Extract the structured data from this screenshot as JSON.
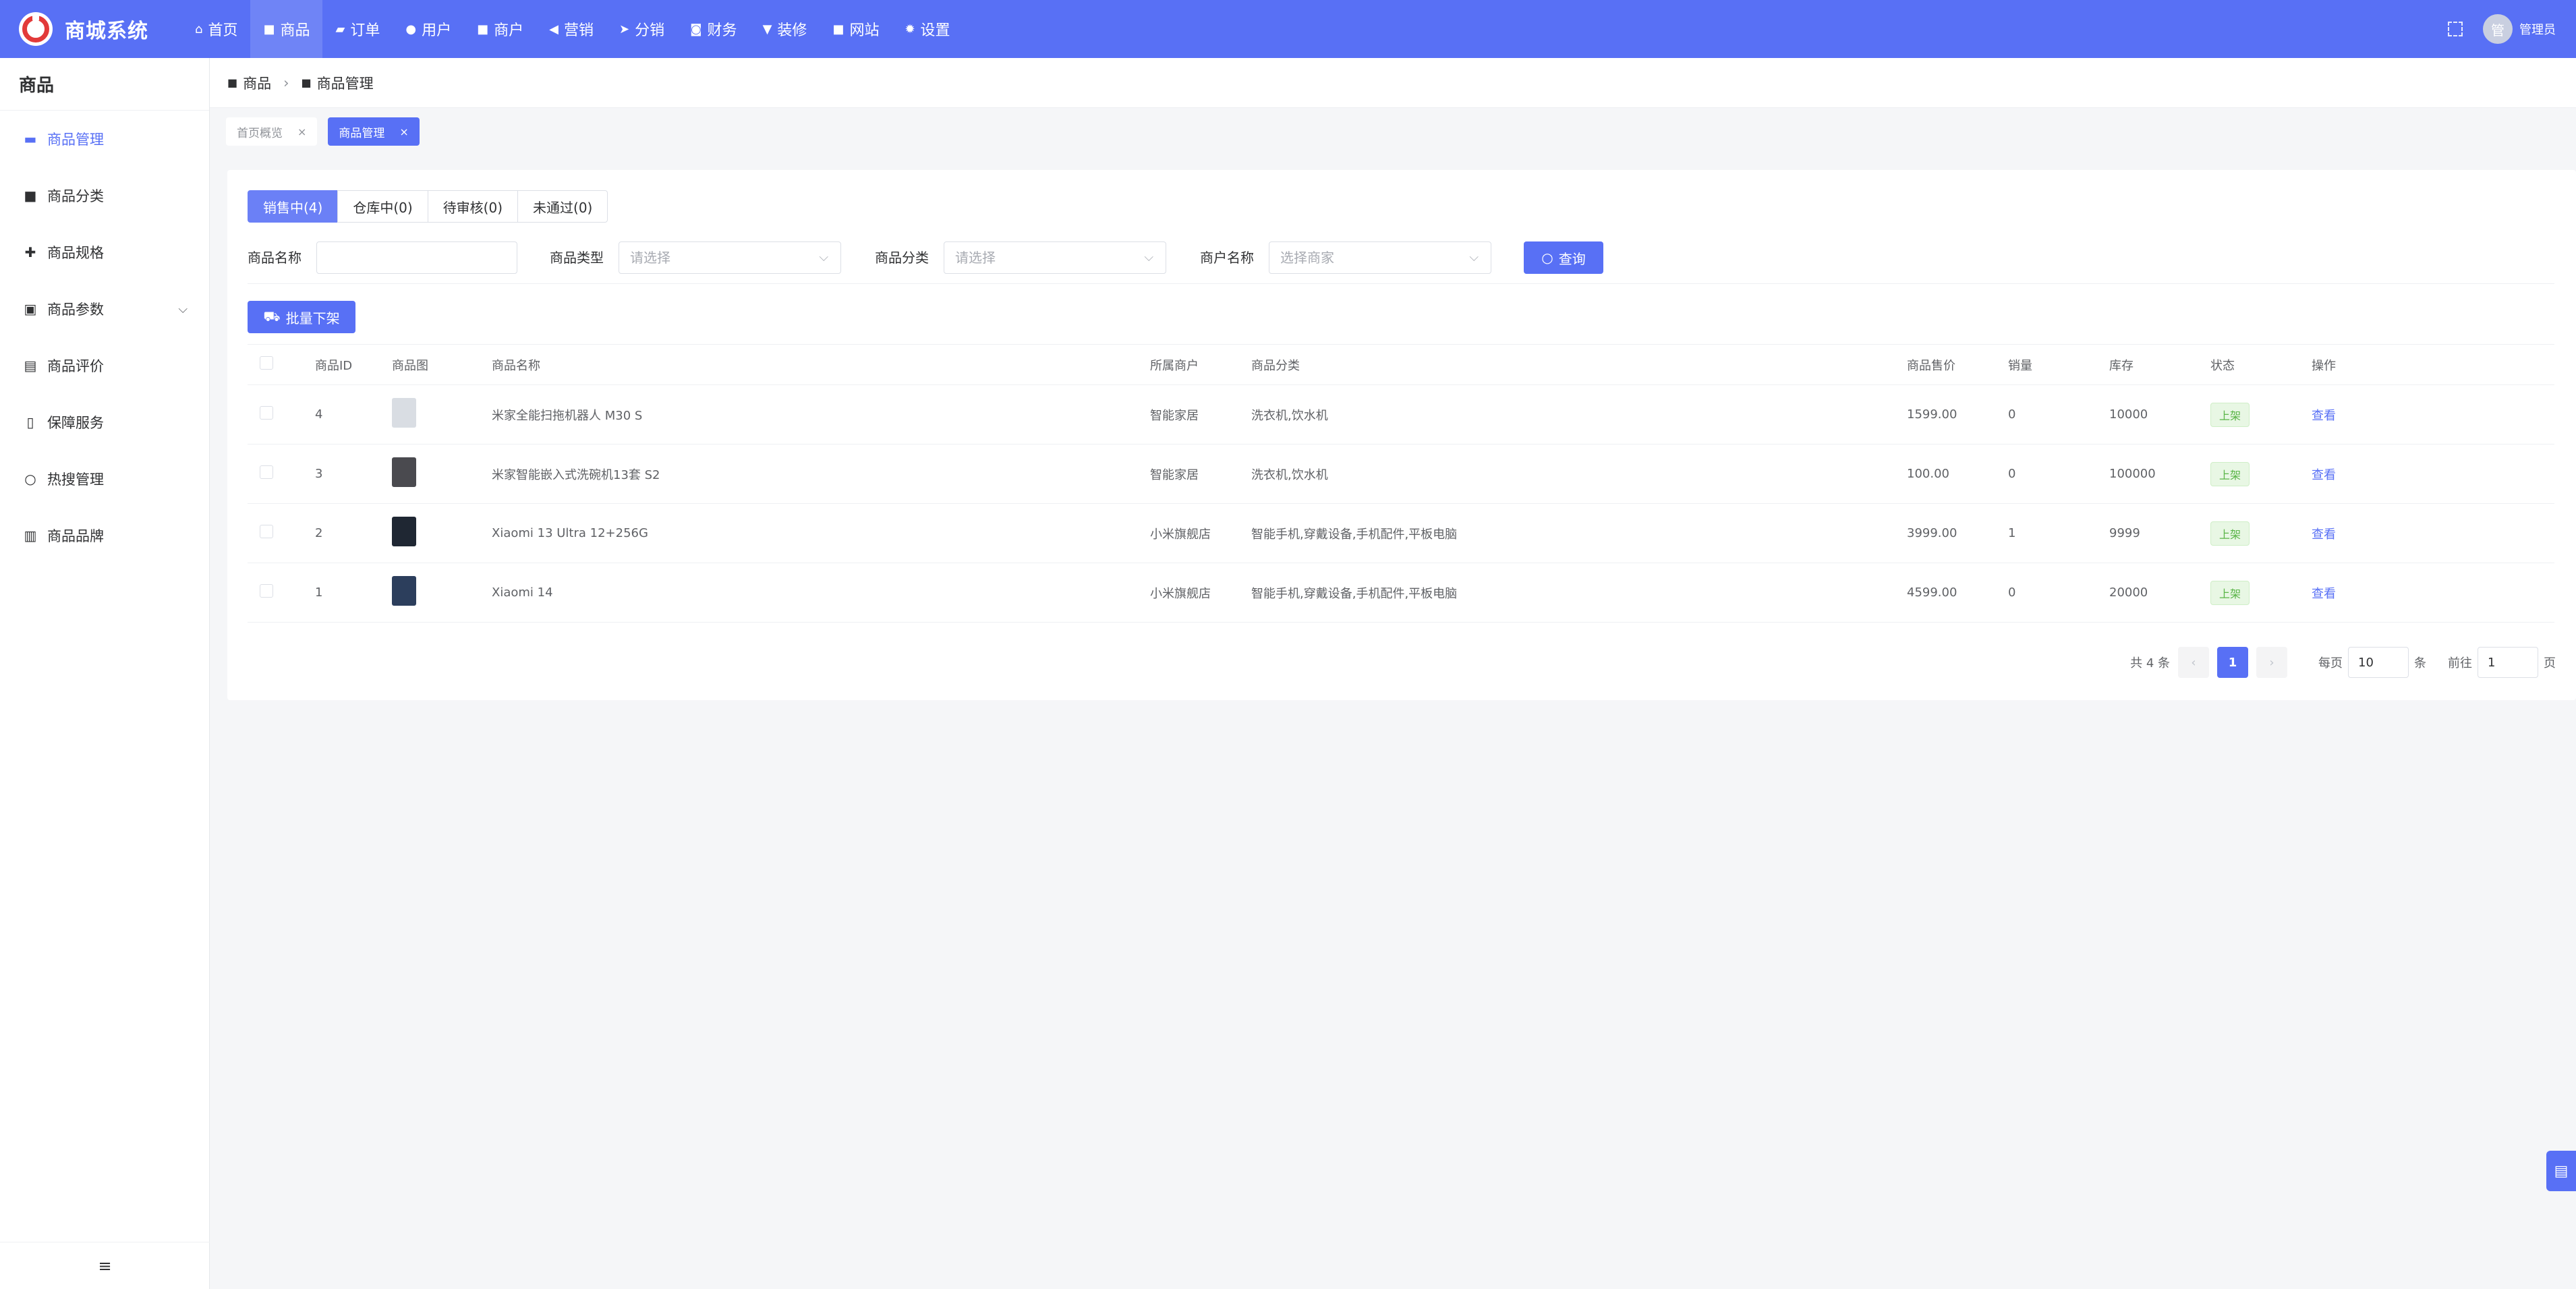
{
  "app": {
    "name": "商城系统"
  },
  "topnav": [
    {
      "label": "首页",
      "icon": "home-icon",
      "glyph": "⌂"
    },
    {
      "label": "商品",
      "icon": "bag-icon",
      "glyph": "■",
      "active": true
    },
    {
      "label": "订单",
      "icon": "order-icon",
      "glyph": "▰"
    },
    {
      "label": "用户",
      "icon": "user-icon",
      "glyph": "●"
    },
    {
      "label": "商户",
      "icon": "shop-icon",
      "glyph": "■"
    },
    {
      "label": "营销",
      "icon": "megaphone-icon",
      "glyph": "◀"
    },
    {
      "label": "分销",
      "icon": "send-icon",
      "glyph": "➤"
    },
    {
      "label": "财务",
      "icon": "wallet-icon",
      "glyph": "◙"
    },
    {
      "label": "装修",
      "icon": "brush-icon",
      "glyph": "▼"
    },
    {
      "label": "网站",
      "icon": "site-icon",
      "glyph": "■"
    },
    {
      "label": "设置",
      "icon": "gear-icon",
      "glyph": "✹"
    }
  ],
  "user": {
    "avatar_text": "管",
    "name": "管理员"
  },
  "sidebar": {
    "title": "商品",
    "items": [
      {
        "label": "商品管理",
        "icon": "briefcase-icon",
        "glyph": "▬",
        "active": true
      },
      {
        "label": "商品分类",
        "icon": "bag-icon",
        "glyph": "■"
      },
      {
        "label": "商品规格",
        "icon": "spec-icon",
        "glyph": "✚"
      },
      {
        "label": "商品参数",
        "icon": "clipboard-icon",
        "glyph": "▣",
        "expandable": true
      },
      {
        "label": "商品评价",
        "icon": "comment-icon",
        "glyph": "▤"
      },
      {
        "label": "保障服务",
        "icon": "document-icon",
        "glyph": "▯"
      },
      {
        "label": "热搜管理",
        "icon": "search-icon",
        "glyph": "○"
      },
      {
        "label": "商品品牌",
        "icon": "trash-icon",
        "glyph": "▥"
      }
    ],
    "collapse_glyph": "≡"
  },
  "breadcrumb": {
    "root": "商品",
    "current": "商品管理",
    "sep": "›"
  },
  "tabs": [
    {
      "label": "首页概览",
      "active": false
    },
    {
      "label": "商品管理",
      "active": true
    }
  ],
  "status_tabs": [
    {
      "label": "销售中(4)",
      "active": true
    },
    {
      "label": "仓库中(0)"
    },
    {
      "label": "待审核(0)"
    },
    {
      "label": "未通过(0)"
    }
  ],
  "filters": {
    "name_label": "商品名称",
    "name_value": "",
    "type_label": "商品类型",
    "type_placeholder": "请选择",
    "category_label": "商品分类",
    "category_placeholder": "请选择",
    "merchant_label": "商户名称",
    "merchant_placeholder": "选择商家",
    "query_label": "查询"
  },
  "batch_button": "批量下架",
  "table": {
    "headers": [
      "商品ID",
      "商品图",
      "商品名称",
      "所属商户",
      "商品分类",
      "商品售价",
      "销量",
      "库存",
      "状态",
      "操作"
    ],
    "rows": [
      {
        "id": "4",
        "name": "米家全能扫拖机器人 M30 S",
        "merchant": "智能家居",
        "category": "洗衣机,饮水机",
        "price": "1599.00",
        "sales": "0",
        "stock": "10000",
        "status": "上架",
        "action": "查看",
        "thumb": "#d9dde3"
      },
      {
        "id": "3",
        "name": "米家智能嵌入式洗碗机13套 S2",
        "merchant": "智能家居",
        "category": "洗衣机,饮水机",
        "price": "100.00",
        "sales": "0",
        "stock": "100000",
        "status": "上架",
        "action": "查看",
        "thumb": "#4a4a4f"
      },
      {
        "id": "2",
        "name": "Xiaomi 13 Ultra 12+256G",
        "merchant": "小米旗舰店",
        "category": "智能手机,穿戴设备,手机配件,平板电脑",
        "price": "3999.00",
        "sales": "1",
        "stock": "9999",
        "status": "上架",
        "action": "查看",
        "thumb": "#1f2733"
      },
      {
        "id": "1",
        "name": "Xiaomi 14",
        "merchant": "小米旗舰店",
        "category": "智能手机,穿戴设备,手机配件,平板电脑",
        "price": "4599.00",
        "sales": "0",
        "stock": "20000",
        "status": "上架",
        "action": "查看",
        "thumb": "#2c3e5c"
      }
    ]
  },
  "pager": {
    "total": "共 4 条",
    "page": "1",
    "per_page_label": "每页",
    "per_page_value": "10",
    "per_page_unit": "条",
    "goto_label": "前往",
    "goto_value": "1",
    "goto_unit": "页"
  },
  "colors": {
    "primary": "#5870f5",
    "status_green": "#5ab548"
  }
}
